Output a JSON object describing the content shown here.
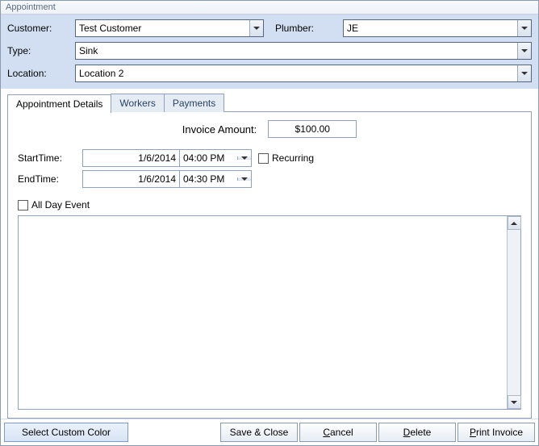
{
  "window": {
    "title": "Appointment"
  },
  "header": {
    "customer_label": "Customer:",
    "customer_value": "Test Customer",
    "plumber_label": "Plumber:",
    "plumber_value": "JE",
    "type_label": "Type:",
    "type_value": "Sink",
    "location_label": "Location:",
    "location_value": "Location 2"
  },
  "tabs": {
    "details": "Appointment Details",
    "workers": "Workers",
    "payments": "Payments"
  },
  "details": {
    "invoice_label": "Invoice Amount:",
    "invoice_value": "$100.00",
    "start_label": "StartTime:",
    "start_date": "1/6/2014",
    "start_time": "04:00 PM",
    "end_label": "EndTime:",
    "end_date": "1/6/2014",
    "end_time": "04:30 PM",
    "recurring_label": "Recurring",
    "allday_label": "All Day Event",
    "notes": ""
  },
  "footer": {
    "color": "Select Custom Color",
    "save": "Save & Close",
    "cancel": "ancel",
    "cancel_u": "C",
    "delete": "elete",
    "delete_u": "D",
    "print": "rint Invoice",
    "print_u": "P"
  }
}
